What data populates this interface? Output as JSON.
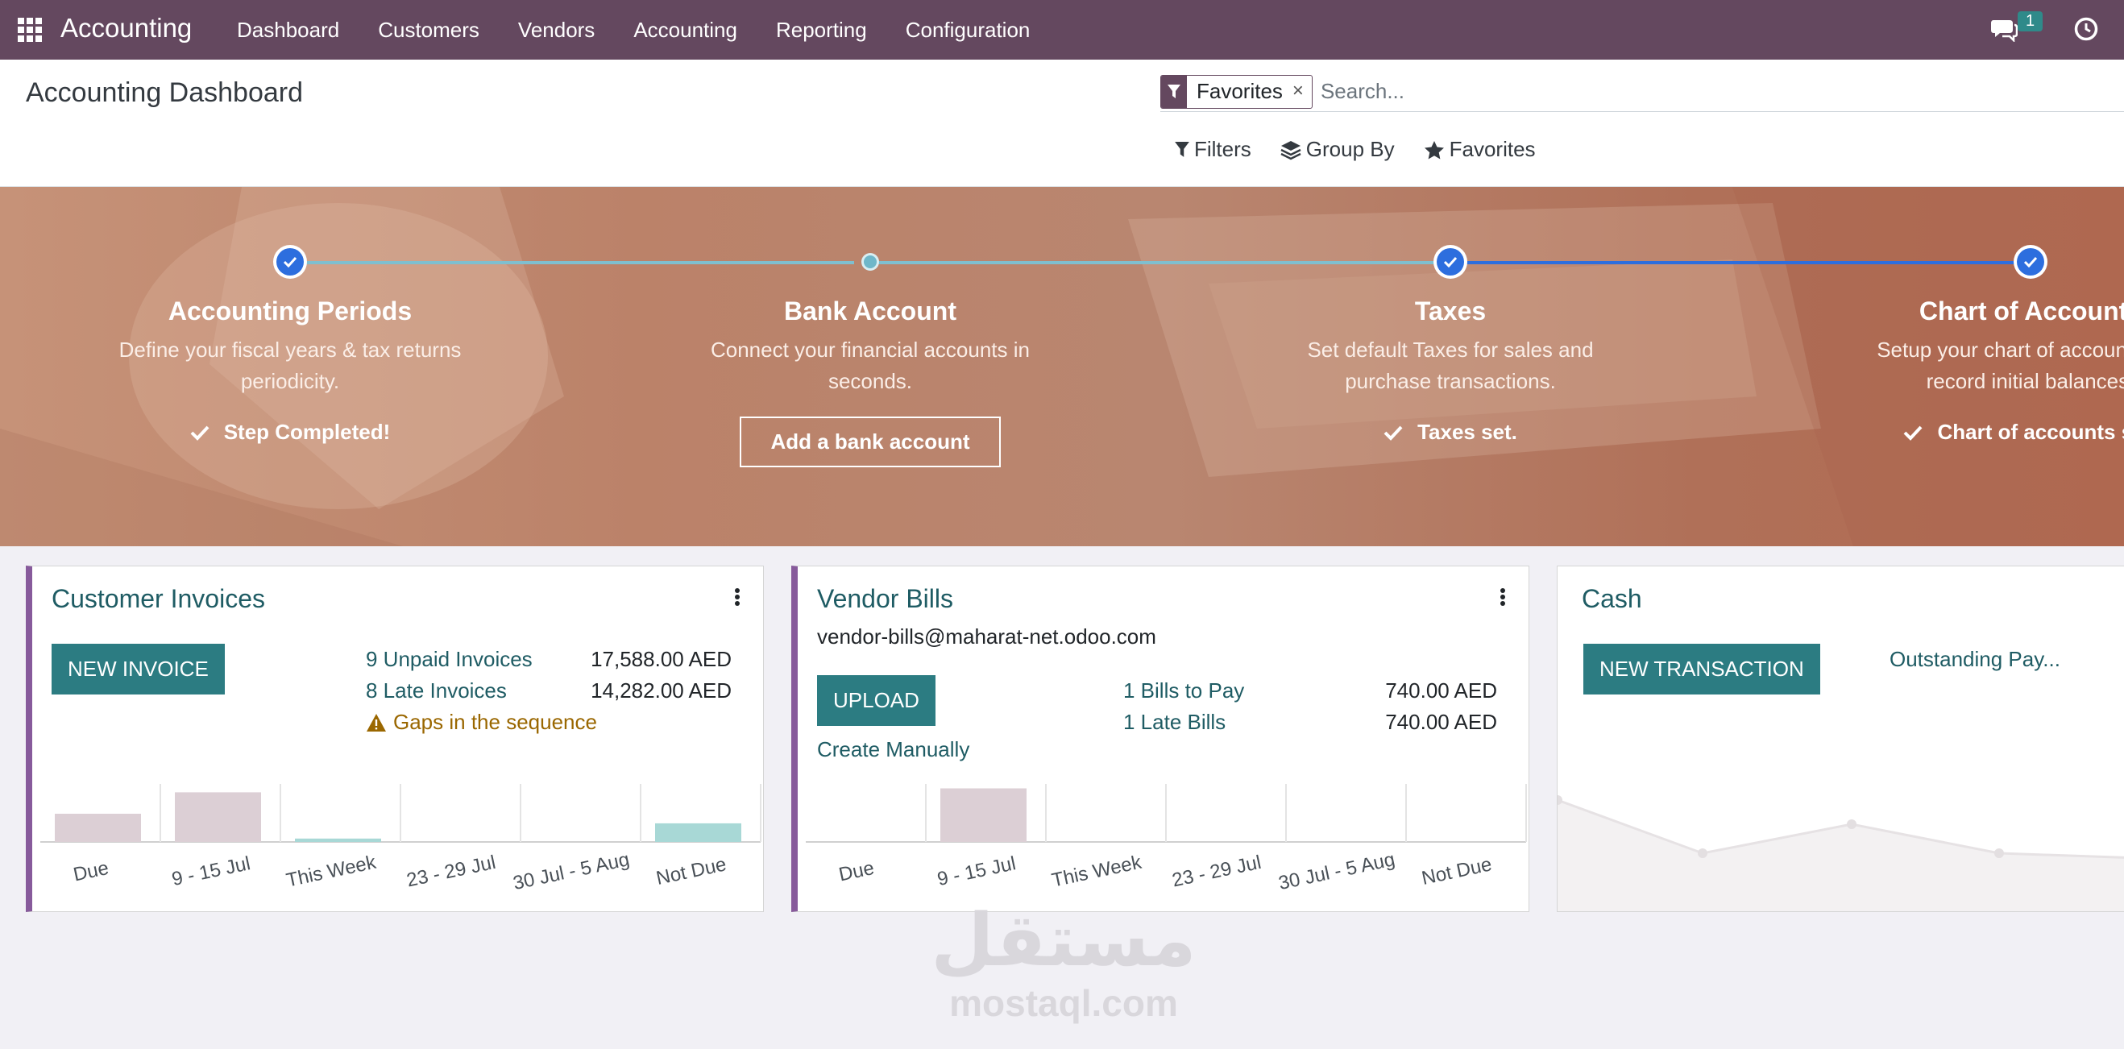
{
  "navbar": {
    "brand": "Accounting",
    "menu": [
      "Dashboard",
      "Customers",
      "Vendors",
      "Accounting",
      "Reporting",
      "Configuration"
    ],
    "chat_count": "1"
  },
  "control": {
    "title": "Accounting Dashboard",
    "facet_label": "Favorites",
    "facet_close": "×",
    "search_placeholder": "Search...",
    "filters_label": "Filters",
    "groupby_label": "Group By",
    "favorites_label": "Favorites"
  },
  "onboarding": {
    "steps": [
      {
        "title": "Accounting Periods",
        "desc_1": "Define your fiscal years & tax returns",
        "desc_2": "periodicity.",
        "done": "Step Completed!",
        "completed": true
      },
      {
        "title": "Bank Account",
        "desc_1": "Connect your financial accounts in",
        "desc_2": "seconds.",
        "button": "Add a bank account",
        "completed": false
      },
      {
        "title": "Taxes",
        "desc_1": "Set default Taxes for sales and",
        "desc_2": "purchase transactions.",
        "done": "Taxes set.",
        "completed": true
      },
      {
        "title": "Chart of Accounts",
        "desc_1": "Setup your chart of accounts and",
        "desc_2": "record initial balances.",
        "done": "Chart of accounts set.",
        "completed": true
      }
    ]
  },
  "cards": {
    "customer_invoices": {
      "title": "Customer Invoices",
      "button": "NEW INVOICE",
      "stats": [
        {
          "label": "9 Unpaid Invoices",
          "value": "17,588.00 AED"
        },
        {
          "label": "8 Late Invoices",
          "value": "14,282.00 AED"
        }
      ],
      "warning": "Gaps in the sequence",
      "chart_labels": [
        "Due",
        "9 - 15 Jul",
        "This Week",
        "23 - 29 Jul",
        "30 Jul - 5 Aug",
        "Not Due"
      ],
      "chart_values": [
        0.5,
        0.88,
        0.06,
        0,
        0,
        0.33
      ]
    },
    "vendor_bills": {
      "title": "Vendor Bills",
      "email": "vendor-bills@maharat-net.odoo.com",
      "button": "UPLOAD",
      "create_link": "Create Manually",
      "stats": [
        {
          "label": "1 Bills to Pay",
          "value": "740.00 AED"
        },
        {
          "label": "1 Late Bills",
          "value": "740.00 AED"
        }
      ],
      "chart_labels": [
        "Due",
        "9 - 15 Jul",
        "This Week",
        "23 - 29 Jul",
        "30 Jul - 5 Aug",
        "Not Due"
      ],
      "chart_values": [
        0,
        0.95,
        0,
        0,
        0,
        0
      ]
    },
    "cash": {
      "title": "Cash",
      "button": "NEW TRANSACTION",
      "outstanding": "Outstanding Pay..."
    }
  },
  "watermark": {
    "arabic": "مستقل",
    "latin": "mostaql.com"
  },
  "colors": {
    "navbar": "#64485f",
    "primary": "#2c7c82",
    "accent": "#875a9b",
    "step_done": "#2d6ede"
  }
}
